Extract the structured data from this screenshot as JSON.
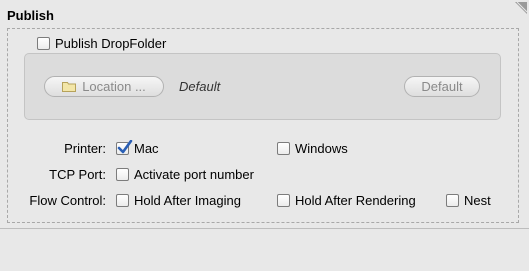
{
  "panel": {
    "title": "Publish"
  },
  "publish_dropfolder": {
    "label": "Publish DropFolder",
    "checked": false
  },
  "location": {
    "button_label": "Location ...",
    "value": "Default",
    "default_button_label": "Default"
  },
  "printer": {
    "label": "Printer:",
    "mac_label": "Mac",
    "mac_checked": true,
    "windows_label": "Windows",
    "windows_checked": false
  },
  "tcp": {
    "label": "TCP Port:",
    "activate_label": "Activate port number",
    "activate_checked": false
  },
  "flow": {
    "label": "Flow Control:",
    "hold_imaging_label": "Hold After Imaging",
    "hold_imaging_checked": false,
    "hold_rendering_label": "Hold After Rendering",
    "hold_rendering_checked": false,
    "nest_label": "Nest",
    "nest_checked": false
  },
  "colors": {
    "check_blue": "#2a5fb5",
    "panel_bg": "#e8e8e8",
    "inset_bg": "#dcdcdc"
  },
  "icons": {
    "folder": "folder-icon",
    "corner": "resize-corner-icon",
    "check": "checkmark-icon"
  }
}
